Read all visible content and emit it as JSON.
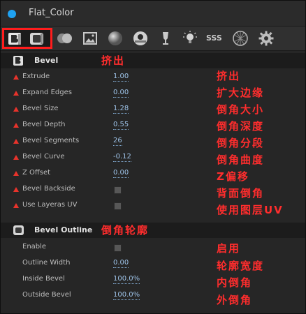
{
  "window": {
    "title": "Flat_Color",
    "accent": "#1fa2f2"
  },
  "toolbar": {
    "icons": [
      "bevel-cap-icon",
      "bevel-outline-icon",
      "spheres-icon",
      "image-icon",
      "sphere-icon",
      "eye-sphere-icon",
      "glass-icon",
      "bulb-icon",
      "sss-icon",
      "hex-sphere-icon",
      "gear-icon"
    ],
    "sss_label": "SSS",
    "highlight_color": "#ff1d1d"
  },
  "bevel": {
    "title": "Bevel",
    "annotation": "挤出",
    "rows": [
      {
        "label": "Extrude",
        "value": "1.00",
        "note": "挤出"
      },
      {
        "label": "Expand Edges",
        "value": "0.00",
        "note": "扩大边缘"
      },
      {
        "label": "Bevel Size",
        "value": "1.28",
        "note": "倒角大小"
      },
      {
        "label": "Bevel Depth",
        "value": "0.55",
        "note": "倒角深度"
      },
      {
        "label": "Bevel Segments",
        "value": "26",
        "note": "倒角分段"
      },
      {
        "label": "Bevel Curve",
        "value": "-0.12",
        "note": "倒角曲度"
      },
      {
        "label": "Z Offset",
        "value": "0.00",
        "note": "Z偏移"
      },
      {
        "label": "Bevel Backside",
        "checked": false,
        "note": "背面倒角"
      },
      {
        "label": "Use Layeras UV",
        "checked": false,
        "note": "使用图层UV"
      }
    ]
  },
  "bevel_outline": {
    "title": "Bevel Outline",
    "annotation": "倒角轮廓",
    "rows": [
      {
        "label": "Enable",
        "checked": false,
        "note": "启用"
      },
      {
        "label": "Outline Width",
        "value": "0.00",
        "note": "轮廓宽度"
      },
      {
        "label": "Inside Bevel",
        "value": "100.0%",
        "note": "内倒角"
      },
      {
        "label": "Outside Bevel",
        "value": "100.0%",
        "note": "外倒角"
      }
    ]
  },
  "colors": {
    "annotation": "#ff2d2d",
    "value_link": "#9ec3e8",
    "required_marker": "#e8332b"
  }
}
